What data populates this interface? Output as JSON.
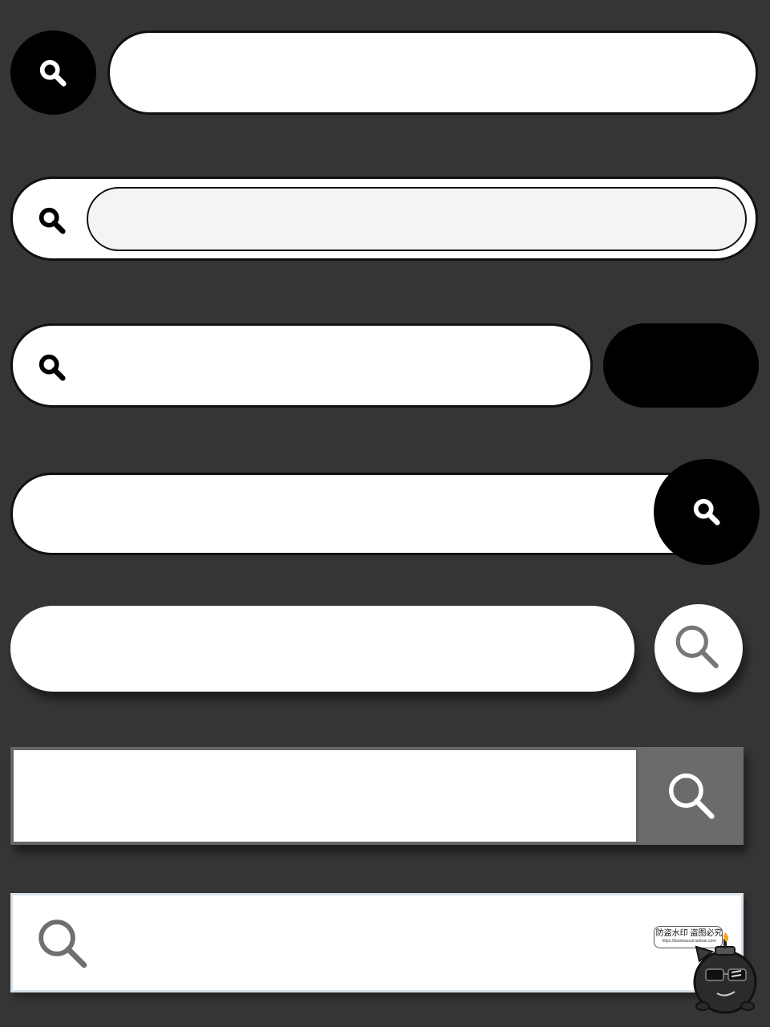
{
  "colors": {
    "background": "#353535",
    "field_fill": "#ffffff",
    "inner_field_fill": "#f4f4f4",
    "outline": "#111111",
    "dark_button": "#000000",
    "grey_button": "#6b6b6b",
    "grey_icon": "#777777",
    "frame_grey": "#666666",
    "frame_light_blue": "#d7e1ec"
  },
  "search_bars": [
    {
      "style": "black-circle-button-left",
      "value": "",
      "icon": "search-icon"
    },
    {
      "style": "double-outline-icon-left",
      "value": "",
      "icon": "search-icon"
    },
    {
      "style": "icon-left-with-black-pill-button",
      "value": "",
      "icon": "search-icon"
    },
    {
      "style": "overlapping-black-circle-button-right",
      "value": "",
      "icon": "search-icon"
    },
    {
      "style": "shadowed-pill-with-circle-button",
      "value": "",
      "icon": "search-icon"
    },
    {
      "style": "square-with-grey-button",
      "value": "",
      "icon": "search-icon"
    },
    {
      "style": "square-icon-inside-left",
      "value": "",
      "icon": "search-icon"
    }
  ],
  "watermark": {
    "line1": "防盗水印 盗图必究",
    "line2": "https://baomaucai.taobao.com"
  }
}
